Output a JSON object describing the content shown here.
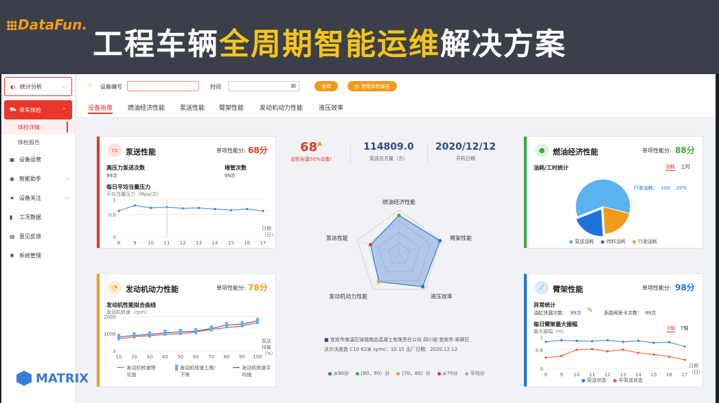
{
  "banner": {
    "logo": "DataFun.",
    "title_part1": "工程车辆",
    "title_highlight": "全周期智能运维",
    "title_part2": "解决方案"
  },
  "watermark": "MATRIX",
  "sidebar": {
    "items": [
      {
        "label": "统计分析",
        "icon": "chart-icon"
      },
      {
        "label": "单车体检",
        "icon": "car-icon"
      },
      {
        "label": "设备运营",
        "icon": "device-icon"
      },
      {
        "label": "智能助手",
        "icon": "assistant-icon"
      },
      {
        "label": "设备关注",
        "icon": "star-icon"
      },
      {
        "label": "工况数据",
        "icon": "data-icon"
      },
      {
        "label": "意见反馈",
        "icon": "feedback-icon"
      },
      {
        "label": "系统管理",
        "icon": "gear-icon"
      }
    ],
    "subitems": [
      "体检详情",
      "体检报告"
    ]
  },
  "toolbar": {
    "device_label": "设备编号",
    "device_value": "",
    "time_label": "时间",
    "time_value": "",
    "query_button": "查询",
    "report_button": "查看体检报告"
  },
  "tabs": [
    "设备画像",
    "燃油经济性能",
    "泵送性能",
    "臂架性能",
    "发动机动力性能",
    "液压效率"
  ],
  "pump_card": {
    "title": "泵送性能",
    "score_label": "单项性能分:",
    "score": "68分",
    "metric1_label": "高压力泵送次数",
    "metric1_value": "99次",
    "metric2_label": "堵管次数",
    "metric2_value": "99次",
    "chart_title": "每日平均当量压力",
    "chart_subtitle": "平均当量压力（Mpa/次）",
    "x_unit": "日期（日）"
  },
  "engine_card": {
    "title": "发动机动力性能",
    "score_label": "单项性能分:",
    "score": "78分",
    "chart_title": "发动机性能拟合曲线",
    "chart_subtitle": "发动机转速（rpm）",
    "x_unit": "泵送排量（%）",
    "legend": [
      "发动机转速理论值",
      "发动机转速上限/下限",
      "发动机转速平均值"
    ]
  },
  "fuel_card": {
    "title": "燃油经济性能",
    "score_label": "单项性能分:",
    "score": "88分",
    "sub_title": "油耗/工时统计",
    "toggle1": "油耗",
    "toggle2": "工时",
    "callout": "行驶油耗：  100    20%",
    "legend": [
      "泵送油耗",
      "待料油耗",
      "行驶油耗"
    ]
  },
  "boom_card": {
    "title": "臂架性能",
    "score_label": "单项性能分:",
    "score": "98分",
    "sub_title": "异常统计",
    "stat1": "油缸泄漏次数：  99次",
    "stat2": "多路阀发卡次数：  99次",
    "chart_title": "每日臂架最大振幅",
    "chart_subtitle": "最大振幅（m）",
    "toggle1": "X轴",
    "toggle2": "Y轴",
    "x_unit": "日期（日）",
    "legend": [
      "泵送状态",
      "非泵送状态"
    ]
  },
  "center": {
    "score": "68",
    "score_note": "击败全国50%设备!",
    "total_value": "114809.0",
    "total_label": "泵送总方量（方）",
    "date_value": "2020/12/12",
    "date_label": "开机日期",
    "radar_axes": [
      "燃油经济性能",
      "臂架性能",
      "液压效率",
      "发动机动力性能",
      "泵送性能"
    ],
    "address": "宜宾市南溪区骑城商品混凝土有限责任公司  四川省·宜宾市·翠屏区",
    "info": "沃尔沃底盘    C10    62米    symc：10.15    出厂日期：2020.12.12",
    "legend": [
      "≥90分",
      "[80，90）分",
      "[70，80）分",
      "≤70分",
      "平均分"
    ]
  },
  "colors": {
    "accent_red": "#e8362b",
    "orange": "#f39a1b",
    "green": "#3aa845",
    "blue": "#1e73d9",
    "light_blue": "#5ab2ee"
  },
  "chart_data": [
    {
      "type": "line",
      "title": "每日平均当量压力",
      "ylabel": "平均当量压力（Mpa/次）",
      "xlabel": "日期（日）",
      "x": [
        8,
        9,
        10,
        11,
        12,
        13,
        14,
        15,
        16,
        17
      ],
      "y": [
        0.7,
        0.85,
        0.78,
        0.8,
        0.77,
        0.78,
        0.75,
        0.72,
        0.75,
        0.7
      ],
      "ylim": [
        0,
        1.0
      ],
      "yticks": [
        0,
        0.6,
        1.0
      ]
    },
    {
      "type": "line",
      "title": "发动机性能拟合曲线",
      "ylabel": "发动机转速（rpm）",
      "xlabel": "泵送排量（%）",
      "x": [
        10,
        20,
        30,
        40,
        50,
        60,
        70,
        80,
        90,
        100
      ],
      "ylim": [
        0,
        2000
      ],
      "yticks": [
        0,
        1000,
        2000
      ],
      "series": [
        {
          "name": "发动机转速理论值",
          "values": [
            700,
            820,
            880,
            950,
            1000,
            1100,
            1250,
            1350,
            1450,
            1650
          ]
        },
        {
          "name": "发动机转速平均值",
          "values": [
            800,
            900,
            950,
            1050,
            1100,
            1150,
            1300,
            1500,
            1550,
            1750
          ]
        }
      ]
    },
    {
      "type": "pie",
      "title": "油耗/工时统计",
      "labels": [
        "泵送油耗",
        "待料油耗",
        "行驶油耗"
      ],
      "values": [
        60,
        20,
        20
      ]
    },
    {
      "type": "line",
      "title": "每日臂架最大振幅",
      "ylabel": "最大振幅（m）",
      "xlabel": "日期（日）",
      "x": [
        8,
        9,
        10,
        11,
        12,
        13,
        14,
        15,
        16,
        17
      ],
      "ylim": [
        0,
        1.0
      ],
      "yticks": [
        0,
        0.6,
        1.0
      ],
      "series": [
        {
          "name": "泵送状态",
          "values": [
            0.85,
            0.9,
            0.88,
            0.87,
            0.9,
            0.85,
            0.88,
            0.82,
            0.84,
            0.7
          ]
        },
        {
          "name": "非泵送状态",
          "values": [
            0.35,
            0.4,
            0.6,
            0.62,
            0.55,
            0.6,
            0.5,
            0.45,
            0.38,
            0.28
          ]
        }
      ]
    },
    {
      "type": "radar",
      "axes": [
        "燃油经济性能",
        "臂架性能",
        "液压效率",
        "发动机动力性能",
        "泵送性能"
      ],
      "values": [
        88,
        98,
        92,
        78,
        68
      ],
      "max": 100
    }
  ]
}
